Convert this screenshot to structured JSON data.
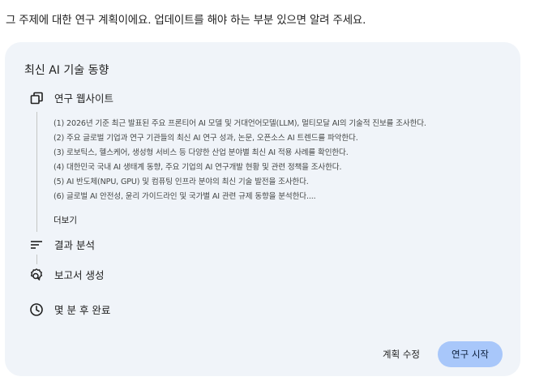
{
  "intro_text": "그 주제에 대한 연구 계획이에요. 업데이트를 해야 하는 부분 있으면 알려 주세요.",
  "card": {
    "title": "최신 AI 기술 동향",
    "steps": [
      {
        "label": "연구 웹사이트",
        "icon": "open-in-new-icon"
      },
      {
        "label": "결과 분석",
        "icon": "notes-icon"
      },
      {
        "label": "보고서 생성",
        "icon": "report-search-icon"
      },
      {
        "label": "몇 분 후 완료",
        "icon": "clock-icon"
      }
    ],
    "plan_items": [
      "(1) 2026년 기준 최근 발표된 주요 프론티어 AI 모델 및 거대언어모델(LLM), 멀티모달 AI의 기술적 진보를 조사한다.",
      "(2) 주요 글로벌 기업과 연구 기관들의 최신 AI 연구 성과, 논문, 오픈소스 AI 트렌드를 파악한다.",
      "(3) 로보틱스, 헬스케어, 생성형 서비스 등 다양한 산업 분야별 최신 AI 적용 사례를 확인한다.",
      "(4) 대한민국 국내 AI 생태계 동향, 주요 기업의 AI 연구개발 현황 및 관련 정책을 조사한다.",
      "(5) AI 반도체(NPU, GPU) 및 컴퓨팅 인프라 분야의 최신 기술 발전을 조사한다.",
      "(6) 글로벌 AI 안전성, 윤리 가이드라인 및 국가별 AI 관련 규제 동향을 분석한다...."
    ],
    "more_label": "더보기",
    "edit_button": "계획 수정",
    "start_button": "연구 시작"
  }
}
